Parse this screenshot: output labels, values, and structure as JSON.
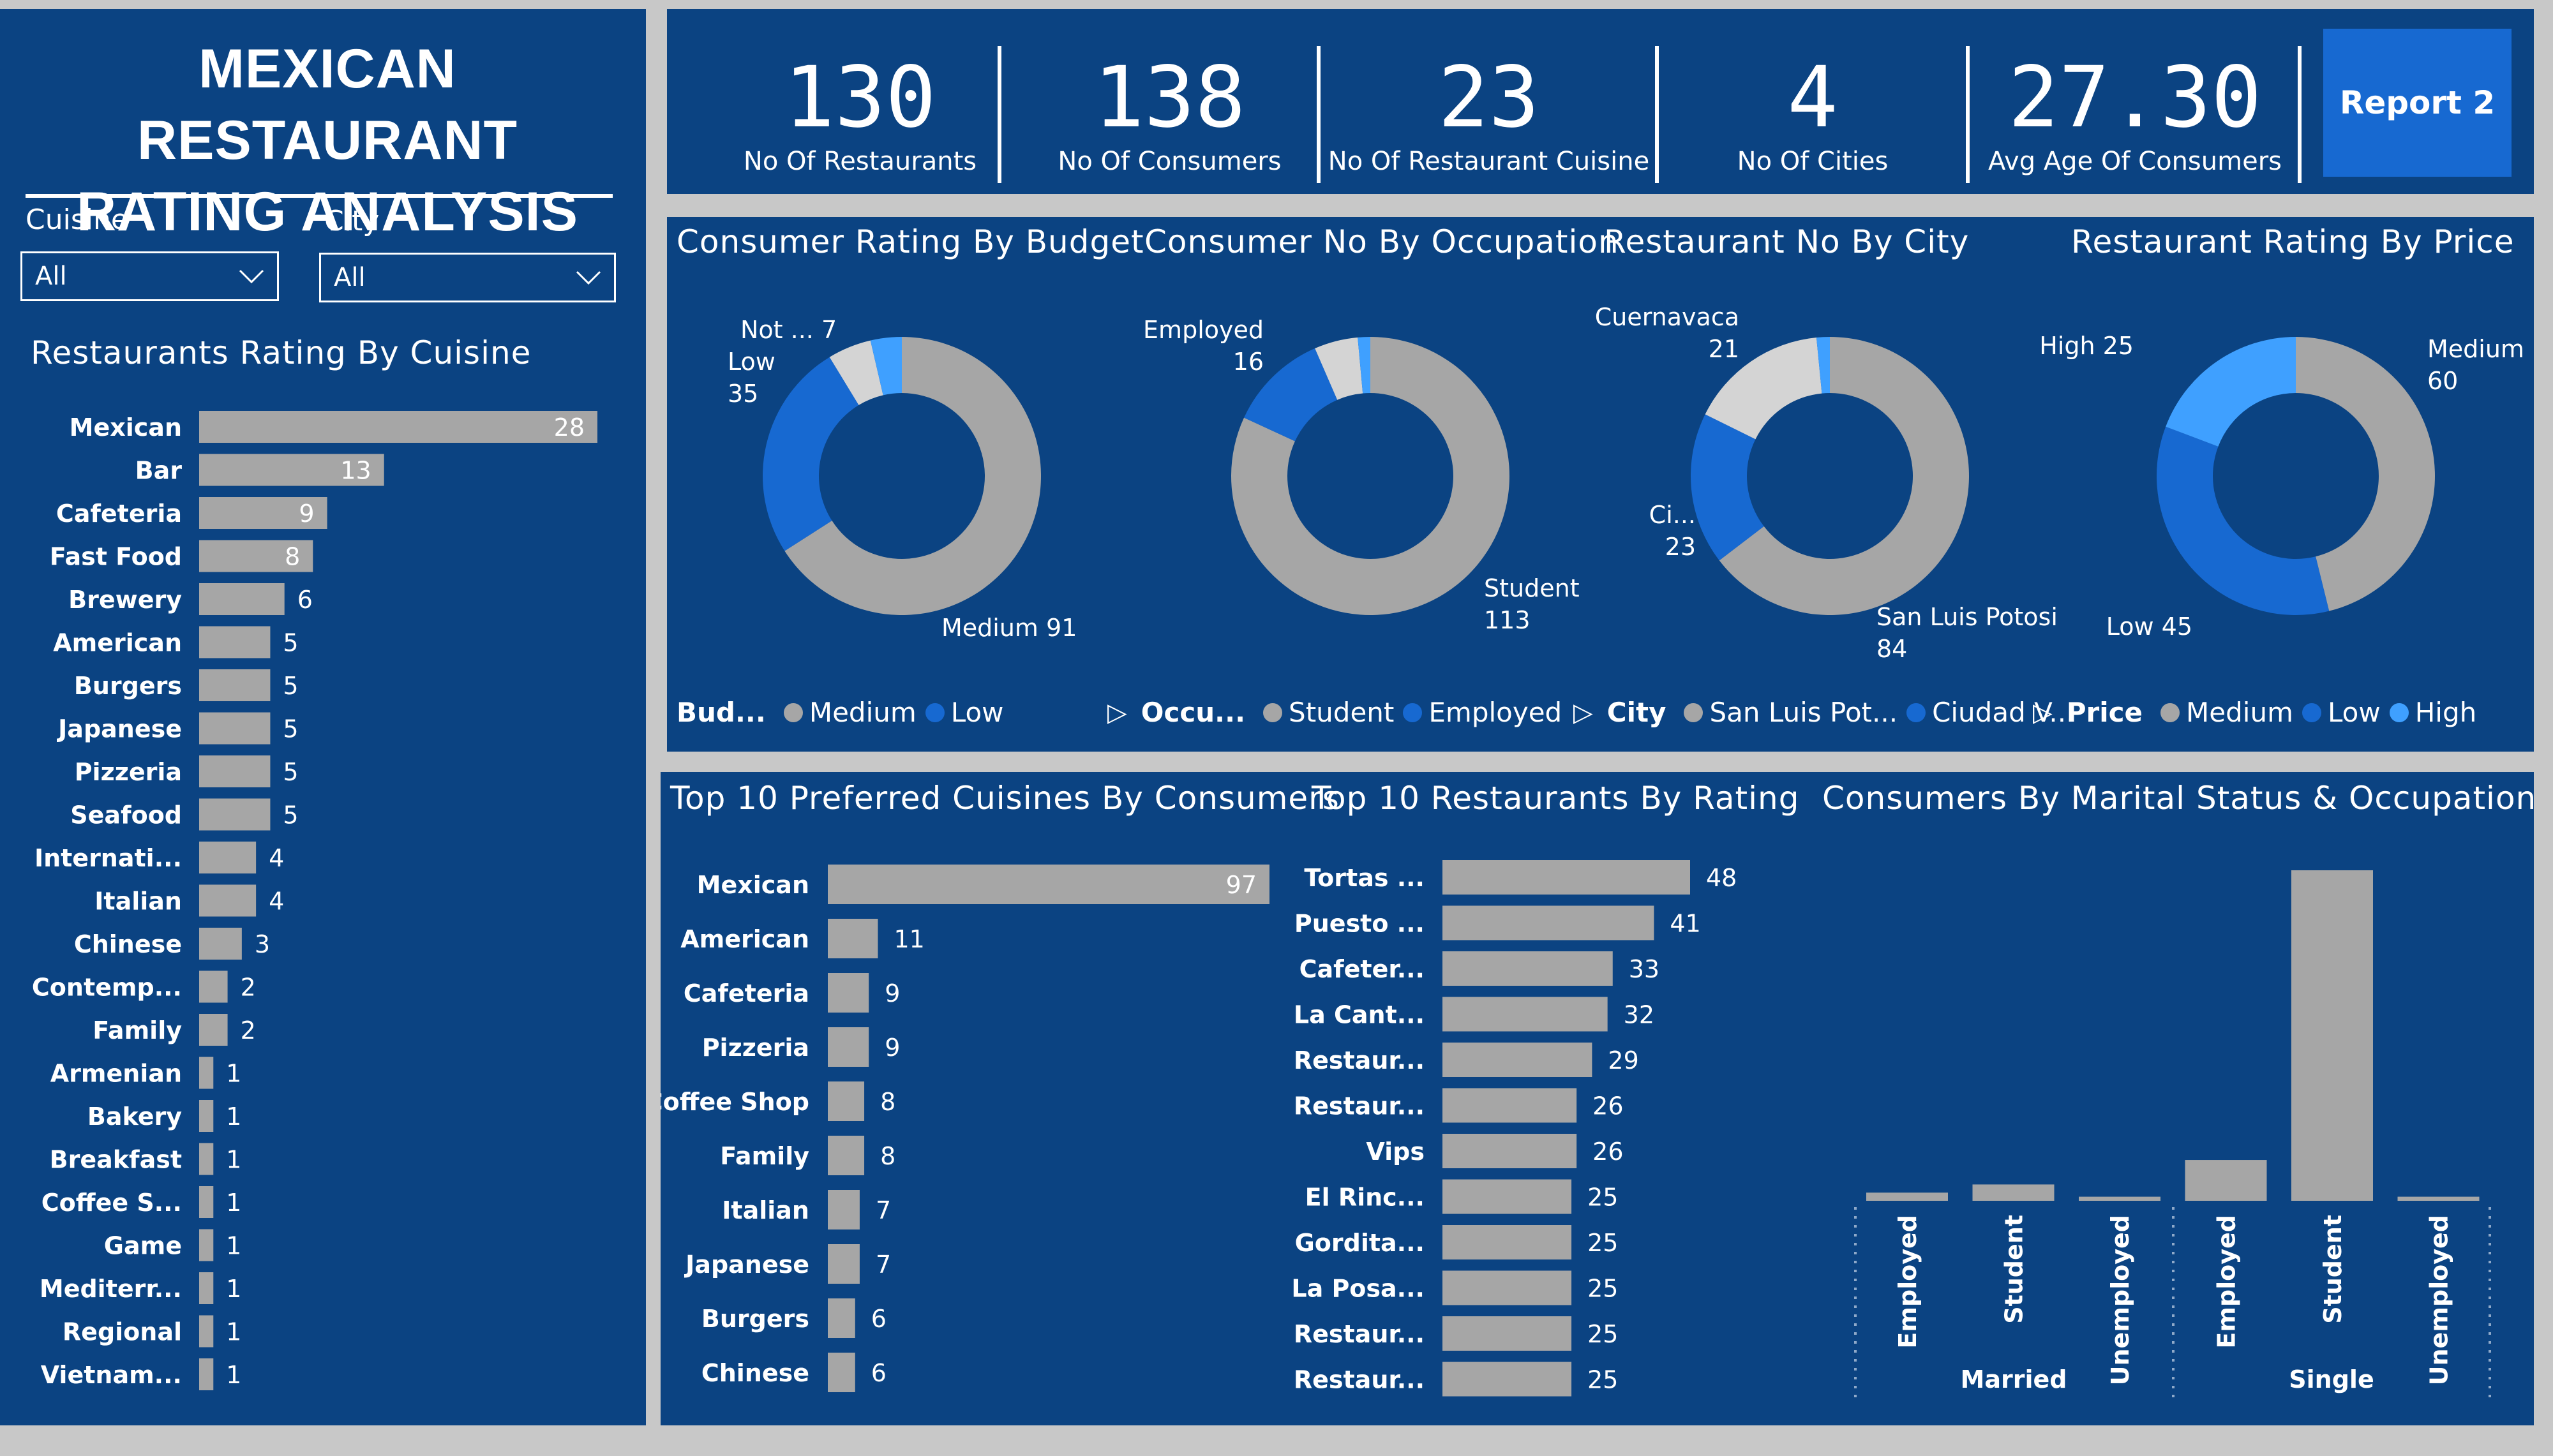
{
  "header": {
    "title_line1": "MEXICAN RESTAURANT",
    "title_line2": "RATING ANALYSIS"
  },
  "filters": {
    "cuisine_label": "Cuisine",
    "cuisine_value": "All",
    "city_label": "City",
    "city_value": "All"
  },
  "kpis": [
    {
      "value": "130",
      "label": "No Of Restaurants"
    },
    {
      "value": "138",
      "label": "No Of Consumers"
    },
    {
      "value": "23",
      "label": "No Of Restaurant Cuisine"
    },
    {
      "value": "4",
      "label": "No Of Cities"
    },
    {
      "value": "27.30",
      "label": "Avg Age Of Consumers"
    }
  ],
  "report_button": "Report 2",
  "colors": {
    "panel": "#0b4382",
    "bar": "#a6a6a6",
    "medium_blue": "#1769d1",
    "light_blue": "#3fa0ff",
    "light_gray": "#d4d4d4"
  },
  "chart_data": [
    {
      "type": "bar",
      "orientation": "horizontal",
      "title": "Restaurants Rating By Cuisine",
      "categories": [
        "Mexican",
        "Bar",
        "Cafeteria",
        "Fast Food",
        "Brewery",
        "American",
        "Burgers",
        "Japanese",
        "Pizzeria",
        "Seafood",
        "Internati...",
        "Italian",
        "Chinese",
        "Contemp...",
        "Family",
        "Armenian",
        "Bakery",
        "Breakfast",
        "Coffee S...",
        "Game",
        "Mediterr...",
        "Regional",
        "Vietnam..."
      ],
      "values": [
        28,
        13,
        9,
        8,
        6,
        5,
        5,
        5,
        5,
        5,
        4,
        4,
        3,
        2,
        2,
        1,
        1,
        1,
        1,
        1,
        1,
        1,
        1
      ]
    },
    {
      "type": "pie",
      "title": "Consumer Rating By Budget",
      "legend_title": "Bud...",
      "legend": [
        "Medium",
        "Low"
      ],
      "slices": [
        {
          "label": "Medium",
          "value": 91,
          "color": "#a6a6a6",
          "text": "Medium 91"
        },
        {
          "label": "Low",
          "value": 35,
          "color": "#1769d1",
          "text": "Low\n35"
        },
        {
          "label": "Not ...",
          "value": 7,
          "color": "#d4d4d4",
          "text": "Not ... 7"
        },
        {
          "label": "",
          "value": 5,
          "color": "#3fa0ff",
          "text": ""
        }
      ]
    },
    {
      "type": "pie",
      "title": "Consumer No By Occupation",
      "legend_title": "Occu...",
      "legend": [
        "Student",
        "Employed"
      ],
      "slices": [
        {
          "label": "Student",
          "value": 113,
          "color": "#a6a6a6",
          "text": "Student\n113"
        },
        {
          "label": "Employed",
          "value": 16,
          "color": "#1769d1",
          "text": "Employed\n16"
        },
        {
          "label": "",
          "value": 7,
          "color": "#d4d4d4",
          "text": ""
        },
        {
          "label": "",
          "value": 2,
          "color": "#3fa0ff",
          "text": ""
        }
      ]
    },
    {
      "type": "pie",
      "title": "Restaurant No By City",
      "legend_title": "City",
      "legend": [
        "San Luis Pot...",
        "Ciudad V..."
      ],
      "slices": [
        {
          "label": "San Luis Potosi",
          "value": 84,
          "color": "#a6a6a6",
          "text": "San Luis Potosi\n84"
        },
        {
          "label": "Ci...",
          "value": 23,
          "color": "#1769d1",
          "text": "Ci...\n23"
        },
        {
          "label": "Cuernavaca",
          "value": 21,
          "color": "#d4d4d4",
          "text": "Cuernavaca\n21"
        },
        {
          "label": "",
          "value": 2,
          "color": "#3fa0ff",
          "text": ""
        }
      ]
    },
    {
      "type": "pie",
      "title": "Restaurant Rating By Price",
      "legend_title": "Price",
      "legend": [
        "Medium",
        "Low",
        "High"
      ],
      "slices": [
        {
          "label": "Medium",
          "value": 60,
          "color": "#a6a6a6",
          "text": "Medium\n60"
        },
        {
          "label": "Low",
          "value": 45,
          "color": "#1769d1",
          "text": "Low 45"
        },
        {
          "label": "High",
          "value": 25,
          "color": "#3fa0ff",
          "text": "High 25"
        }
      ]
    },
    {
      "type": "bar",
      "orientation": "horizontal",
      "title": "Top 10 Preferred Cuisines By Consumers",
      "categories": [
        "Mexican",
        "American",
        "Cafeteria",
        "Pizzeria",
        "Coffee Shop",
        "Family",
        "Italian",
        "Japanese",
        "Burgers",
        "Chinese"
      ],
      "values": [
        97,
        11,
        9,
        9,
        8,
        8,
        7,
        7,
        6,
        6
      ]
    },
    {
      "type": "bar",
      "orientation": "horizontal",
      "title": "Top 10 Restaurants By Rating",
      "categories": [
        "Tortas ...",
        "Puesto ...",
        "Cafeter...",
        "La Cant...",
        "Restaur...",
        "Restaur...",
        "Vips",
        "El Rinc...",
        "Gordita...",
        "La Posa...",
        "Restaur...",
        "Restaur..."
      ],
      "values": [
        48,
        41,
        33,
        32,
        29,
        26,
        26,
        25,
        25,
        25,
        25,
        25
      ]
    },
    {
      "type": "bar",
      "orientation": "vertical",
      "title": "Consumers By Marital Status & Occupation",
      "groups": [
        {
          "name": "Married",
          "categories": [
            "Employed",
            "Student",
            "Unemployed"
          ],
          "values": [
            2,
            4,
            1
          ]
        },
        {
          "name": "Single",
          "categories": [
            "Employed",
            "Student",
            "Unemployed"
          ],
          "values": [
            10,
            81,
            1
          ]
        }
      ]
    }
  ]
}
